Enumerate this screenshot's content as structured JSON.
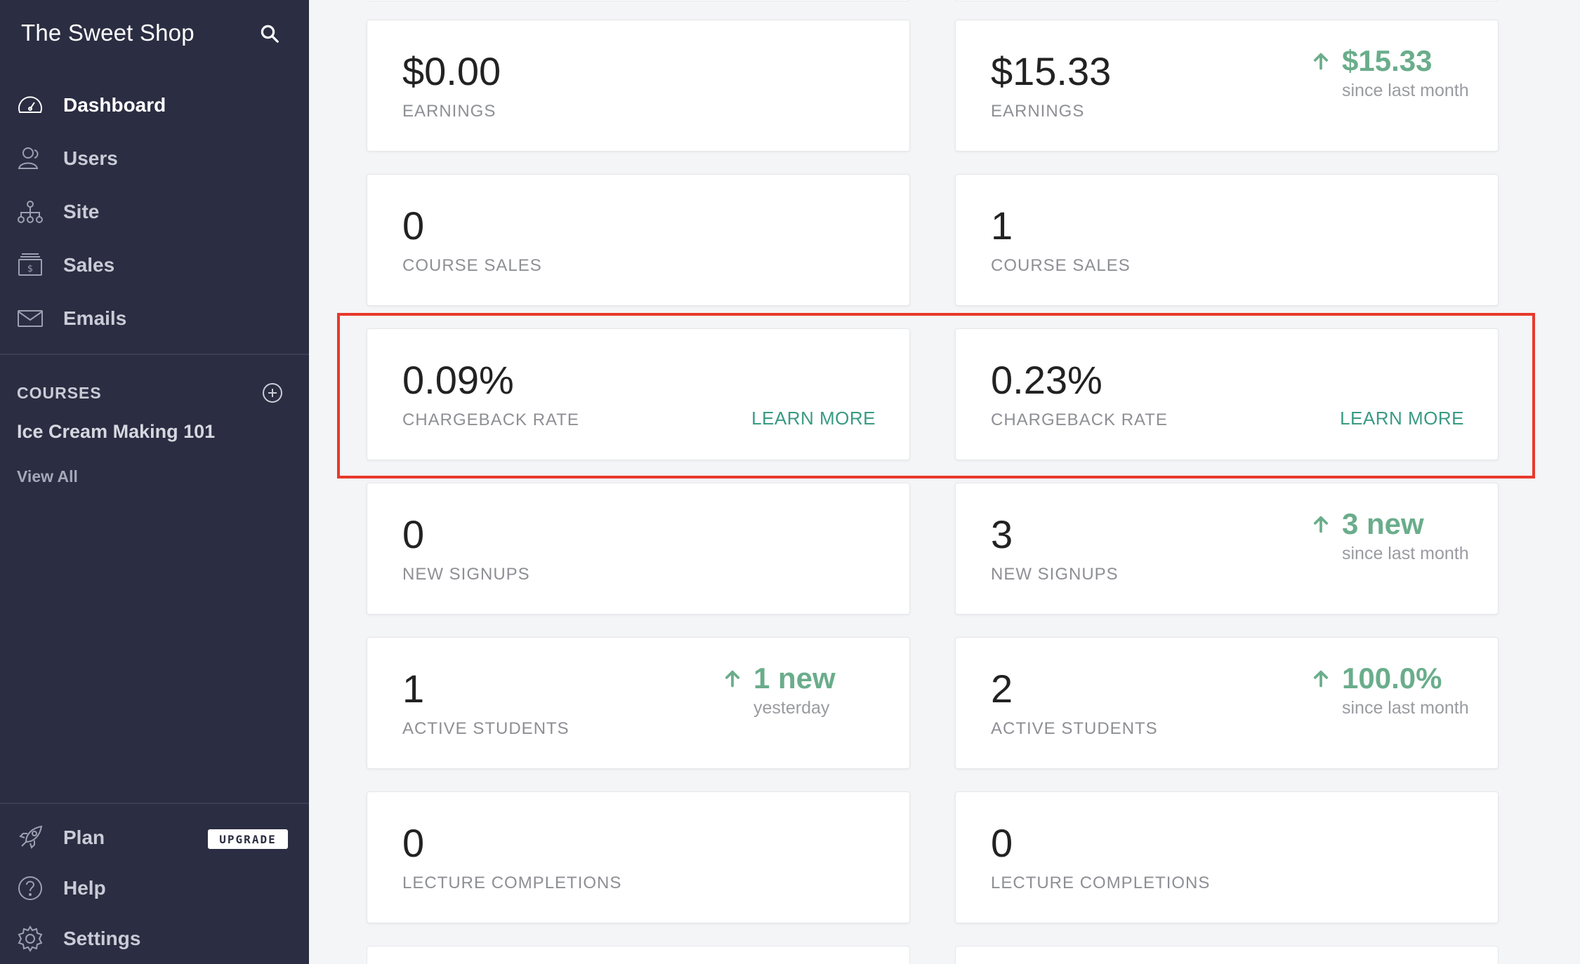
{
  "app": {
    "title": "The Sweet Shop"
  },
  "sidebar": {
    "nav": [
      {
        "label": "Dashboard",
        "icon": "dashboard-gauge-icon",
        "active": true
      },
      {
        "label": "Users",
        "icon": "users-icon",
        "active": false
      },
      {
        "label": "Site",
        "icon": "sitemap-icon",
        "active": false
      },
      {
        "label": "Sales",
        "icon": "sales-icon",
        "active": false
      },
      {
        "label": "Emails",
        "icon": "envelope-icon",
        "active": false
      }
    ],
    "courses_heading": "COURSES",
    "course_item": "Ice Cream Making 101",
    "view_all": "View All",
    "bottom": [
      {
        "label": "Plan",
        "icon": "rocket-icon"
      },
      {
        "label": "Help",
        "icon": "help-circle-icon"
      },
      {
        "label": "Settings",
        "icon": "gear-icon"
      }
    ],
    "upgrade_label": "UPGRADE"
  },
  "cards": {
    "earnings_left": {
      "value": "$0.00",
      "label": "EARNINGS"
    },
    "earnings_right": {
      "value": "$15.33",
      "label": "EARNINGS",
      "delta": "$15.33",
      "delta_sub": "since last month"
    },
    "sales_left": {
      "value": "0",
      "label": "COURSE SALES"
    },
    "sales_right": {
      "value": "1",
      "label": "COURSE SALES"
    },
    "chargeback_left": {
      "value": "0.09%",
      "label": "CHARGEBACK RATE",
      "link": "LEARN MORE"
    },
    "chargeback_right": {
      "value": "0.23%",
      "label": "CHARGEBACK RATE",
      "link": "LEARN MORE"
    },
    "signups_left": {
      "value": "0",
      "label": "NEW SIGNUPS"
    },
    "signups_right": {
      "value": "3",
      "label": "NEW SIGNUPS",
      "delta": "3 new",
      "delta_sub": "since last month"
    },
    "students_left": {
      "value": "1",
      "label": "ACTIVE STUDENTS",
      "delta": "1 new",
      "delta_sub": "yesterday"
    },
    "students_right": {
      "value": "2",
      "label": "ACTIVE STUDENTS",
      "delta": "100.0%",
      "delta_sub": "since last month"
    },
    "lectures_left": {
      "value": "0",
      "label": "LECTURE COMPLETIONS"
    },
    "lectures_right": {
      "value": "0",
      "label": "LECTURE COMPLETIONS"
    }
  },
  "colors": {
    "sidebar_bg": "#2b2d42",
    "positive": "#6aad8b",
    "link": "#3a9a84",
    "highlight": "#e8392b"
  }
}
